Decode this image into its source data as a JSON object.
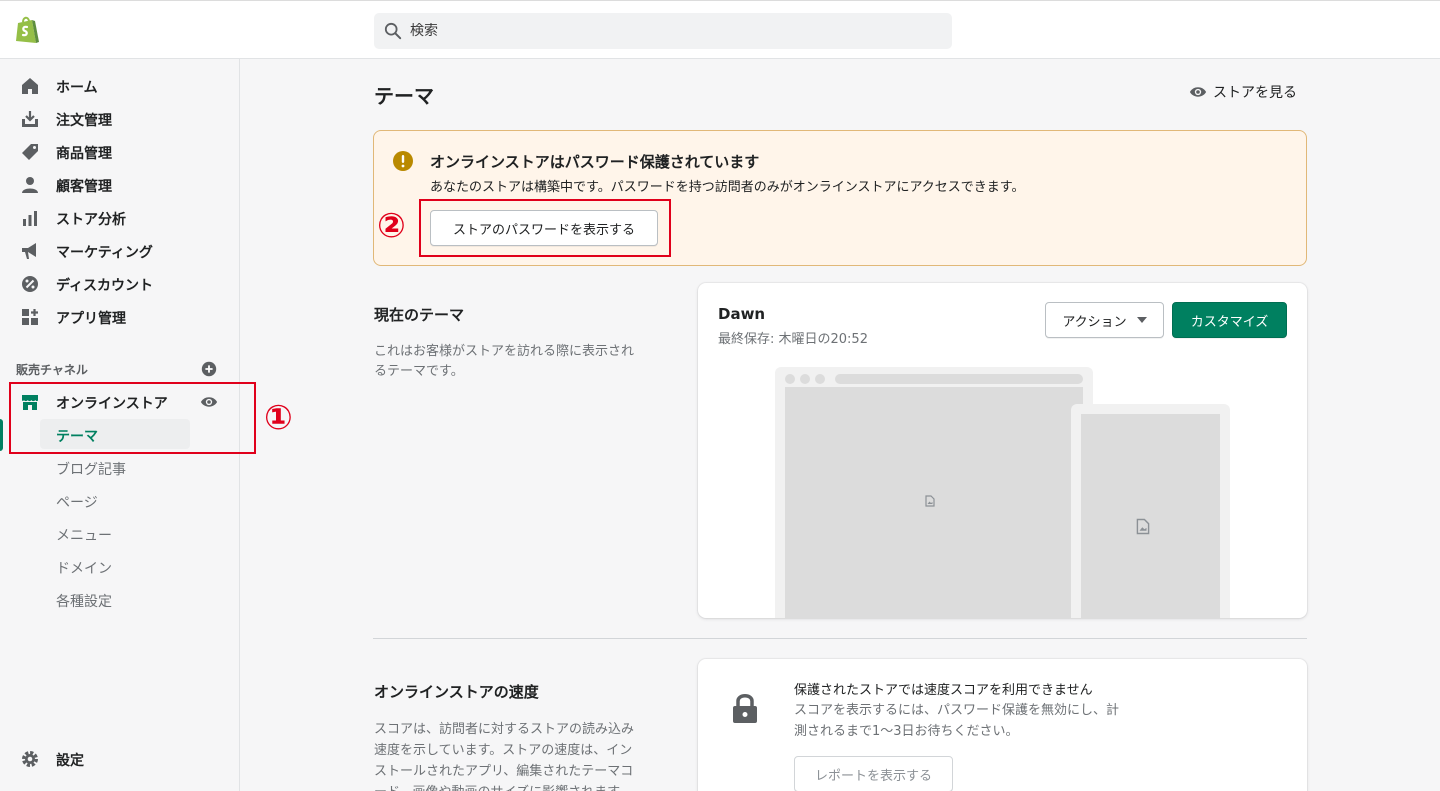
{
  "search": {
    "placeholder": "検索"
  },
  "sidebar": {
    "items": [
      {
        "label": "ホーム"
      },
      {
        "label": "注文管理"
      },
      {
        "label": "商品管理"
      },
      {
        "label": "顧客管理"
      },
      {
        "label": "ストア分析"
      },
      {
        "label": "マーケティング"
      },
      {
        "label": "ディスカウント"
      },
      {
        "label": "アプリ管理"
      }
    ],
    "channels_title": "販売チャネル",
    "online_store": "オンラインストア",
    "sub_items": [
      {
        "label": "テーマ"
      },
      {
        "label": "ブログ記事"
      },
      {
        "label": "ページ"
      },
      {
        "label": "メニュー"
      },
      {
        "label": "ドメイン"
      },
      {
        "label": "各種設定"
      }
    ],
    "settings": "設定"
  },
  "annotations": {
    "one": "①",
    "two": "②",
    "color": "#e0001b"
  },
  "main": {
    "title": "テーマ",
    "view_store": "ストアを見る",
    "banner": {
      "title": "オンラインストアはパスワード保護されています",
      "text": "あなたのストアは構築中です。パスワードを持つ訪問者のみがオンラインストアにアクセスできます。",
      "button": "ストアのパスワードを表示する"
    },
    "current_theme": {
      "heading": "現在のテーマ",
      "desc_line1": "これはお客様がストアを訪れる際に表示され",
      "desc_line2": "るテーマです。",
      "name": "Dawn",
      "saved": "最終保存: 木曜日の20:52",
      "action": "アクション",
      "customize": "カスタマイズ"
    },
    "speed": {
      "heading": "オンラインストアの速度",
      "desc_line1": "スコアは、訪問者に対するストアの読み込み",
      "desc_line2": "速度を示しています。ストアの速度は、イン",
      "desc_line3": "ストールされたアプリ、編集されたテーマコ",
      "desc_line4": "ード、画像や動画のサイズに影響されます。",
      "title": "保護されたストアでは速度スコアを利用できません",
      "text_line1": "スコアを表示するには、パスワード保護を無効にし、計",
      "text_line2": "測されるまで1〜3日お待ちください。",
      "button": "レポートを表示する"
    }
  },
  "colors": {
    "brand_green": "#008060",
    "banner_bg": "#fff5ea",
    "warning": "#b98900"
  }
}
